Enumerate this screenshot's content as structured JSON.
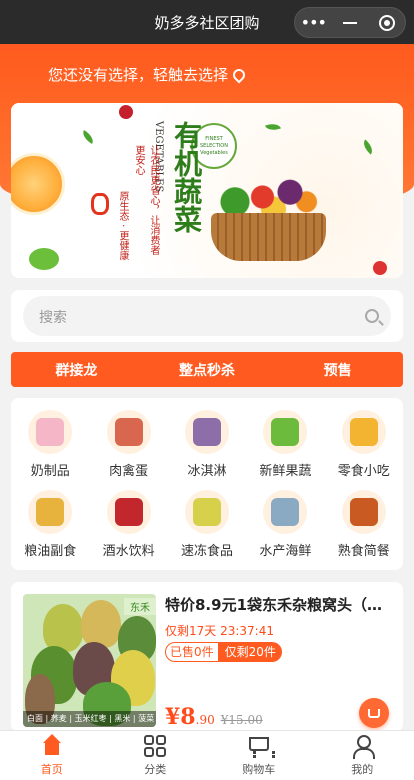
{
  "titlebar": {
    "title": "奶多多社区团购"
  },
  "location": {
    "text": "您还没有选择，轻触去选择"
  },
  "banner": {
    "title": "有机蔬菜",
    "en": "VEGETABLES",
    "line1": "让农民更省心，让消费者更安心",
    "line2": "原生态 · 更健康",
    "badge": "FINEST SELECTION Vegetables"
  },
  "search": {
    "placeholder": "搜索"
  },
  "tabs": [
    "群接龙",
    "整点秒杀",
    "预售"
  ],
  "categories": [
    {
      "label": "奶制品",
      "color": "#f5b6c8"
    },
    {
      "label": "肉禽蛋",
      "color": "#d9664f"
    },
    {
      "label": "冰淇淋",
      "color": "#8e6ea8"
    },
    {
      "label": "新鲜果蔬",
      "color": "#6dbb3c"
    },
    {
      "label": "零食小吃",
      "color": "#f3b531"
    },
    {
      "label": "粮油副食",
      "color": "#e8b33c"
    },
    {
      "label": "酒水饮料",
      "color": "#c1272d"
    },
    {
      "label": "速冻食品",
      "color": "#d6d04a"
    },
    {
      "label": "水产海鲜",
      "color": "#8aa9c2"
    },
    {
      "label": "熟食简餐",
      "color": "#c85a22"
    }
  ],
  "product": {
    "title": "特价8.9元1袋东禾杂粮窝头（…",
    "countdown": "仅剩17天 23:37:41",
    "sold": "已售0件",
    "remaining": "仅剩20件",
    "price_symbol_int": "¥8",
    "price_decimal": ".90",
    "original_price": "¥15.00",
    "image_tag": "东禾",
    "image_strip": "白面 | 荞麦 | 玉米红枣 | 黑米 | 菠菜"
  },
  "tabbar": [
    {
      "label": "首页",
      "icon": "home-icon",
      "active": true
    },
    {
      "label": "分类",
      "icon": "category-icon",
      "active": false
    },
    {
      "label": "购物车",
      "icon": "cart-icon",
      "active": false
    },
    {
      "label": "我的",
      "icon": "user-icon",
      "active": false
    }
  ],
  "colors": {
    "brand": "#ff5a1f",
    "price": "#ff4a1a",
    "titlebar": "#2b2b2b"
  }
}
